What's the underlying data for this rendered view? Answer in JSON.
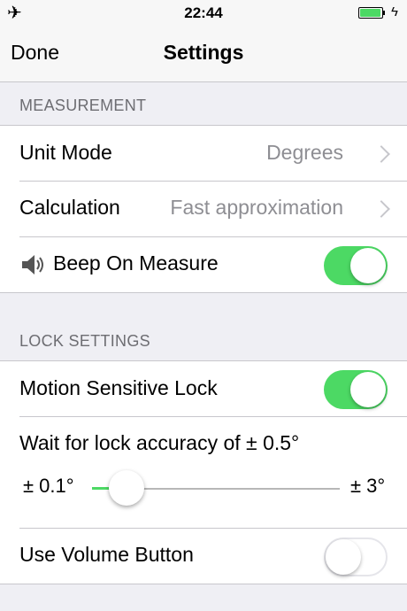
{
  "status_bar": {
    "time": "22:44",
    "airplane_glyph": "✈",
    "charging_glyph": "ϟ",
    "battery_color": "#4cd964"
  },
  "nav": {
    "done_label": "Done",
    "title": "Settings"
  },
  "measurement": {
    "header": "MEASUREMENT",
    "unit_mode_label": "Unit Mode",
    "unit_mode_value": "Degrees",
    "calculation_label": "Calculation",
    "calculation_value": "Fast approximation",
    "beep_label": "Beep On Measure",
    "beep_on": true
  },
  "lock_settings": {
    "header": "LOCK SETTINGS",
    "motion_lock_label": "Motion Sensitive Lock",
    "motion_lock_on": true,
    "accuracy_label": "Wait for lock accuracy of ± 0.5°",
    "slider_min_label": "± 0.1°",
    "slider_max_label": "± 3°",
    "slider_value": 0.5,
    "slider_min": 0.1,
    "slider_max": 3,
    "volume_button_label": "Use Volume Button",
    "volume_button_on": false
  },
  "colors": {
    "accent": "#4cd964",
    "background": "#efeff4",
    "secondary_text": "#8e8e93"
  }
}
